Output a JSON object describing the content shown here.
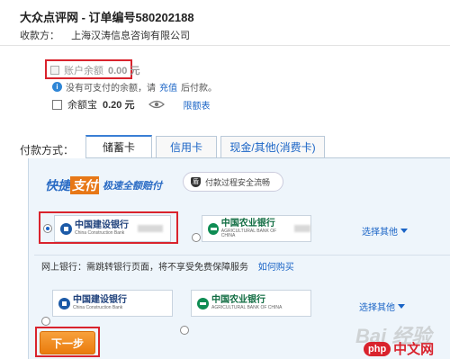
{
  "order": {
    "title": "大众点评网 - 订单编号580202188",
    "payee_label": "收款方：",
    "payee_name": "上海汉涛信息咨询有限公司"
  },
  "balance": {
    "account_label": "账户余额",
    "account_amount": "0.00 元",
    "notice_pre": "没有可支付的余额，请",
    "notice_link": "充值",
    "notice_post": "后付款。",
    "yuebao_label": "余额宝",
    "yuebao_amount": "0.20 元",
    "quota_link": "限额表"
  },
  "payment": {
    "label": "付款方式：",
    "tabs": [
      {
        "label": "储蓄卡"
      },
      {
        "label": "信用卡"
      },
      {
        "label": "现金/其他(消费卡)"
      }
    ]
  },
  "quick": {
    "banner_part1": "快捷",
    "banner_part2": "支付",
    "banner_part3": "极速全额赔付",
    "secure_icon": "盾",
    "secure_text": "付款过程安全流畅"
  },
  "banks": {
    "ccb_cn": "中国建设银行",
    "ccb_en": "China Construction Bank",
    "abc_cn": "中国农业银行",
    "abc_en": "AGRICULTURAL BANK OF CHINA",
    "more": "选择其他"
  },
  "netbank": {
    "text": "网上银行：需跳转银行页面，将不享受免费保障服务",
    "link": "如何购买"
  },
  "next_button": "下一步",
  "watermark": {
    "baidu": "Bai 经验",
    "php_logo": "php",
    "php_text": "中文网"
  }
}
